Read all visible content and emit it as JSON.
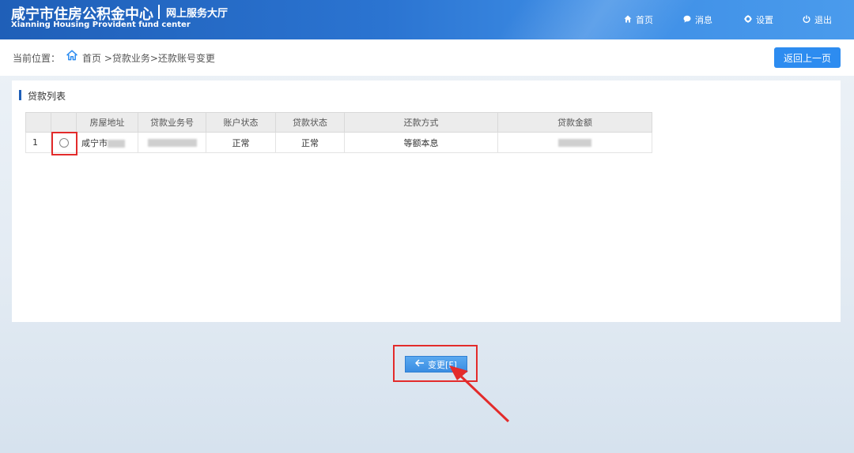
{
  "header": {
    "title_cn": "咸宁市住房公积金中心",
    "subtitle_cn": "网上服务大厅",
    "title_en": "Xianning Housing Provident fund center",
    "nav": [
      {
        "label": "首页",
        "icon": "home-icon"
      },
      {
        "label": "消息",
        "icon": "message-icon"
      },
      {
        "label": "设置",
        "icon": "gear-icon"
      },
      {
        "label": "退出",
        "icon": "power-icon"
      }
    ]
  },
  "breadcrumb": {
    "label": "当前位置：",
    "path": "首页 >贷款业务>还款账号变更",
    "back_button": "返回上一页"
  },
  "panel": {
    "title": "贷款列表",
    "columns": [
      "房屋地址",
      "贷款业务号",
      "账户状态",
      "贷款状态",
      "还款方式",
      "贷款金额"
    ],
    "rows": [
      {
        "index": "1",
        "address": "咸宁市",
        "account_status": "正常",
        "loan_status": "正常",
        "repay_method": "等额本息"
      }
    ]
  },
  "change_button": "变更[F]",
  "colors": {
    "header_blue": "#2b74d1",
    "button_blue": "#2d8cf0",
    "highlight_red": "#e32b2b"
  }
}
